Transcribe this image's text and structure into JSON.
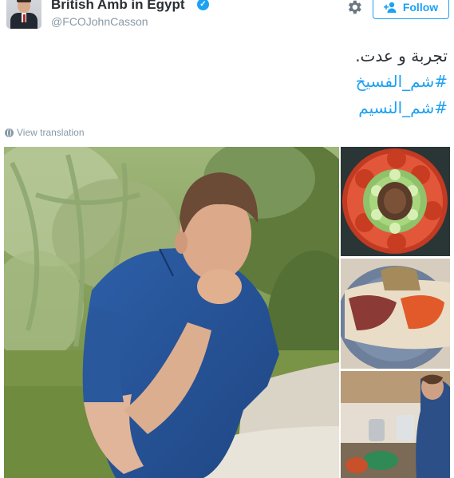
{
  "header": {
    "display_name": "British Amb in Egypt",
    "handle": "@FCOJohnCasson",
    "verified_icon": "verified-badge-icon",
    "follow_label": "Follow"
  },
  "tweet": {
    "lines": [
      "تجربة و عدت.",
      "#شم_الفسيخ",
      "#شم_النسيم"
    ],
    "view_translation": "View translation"
  },
  "media": {
    "photos": [
      "man-eating-photo",
      "fish-tomato-platter-photo",
      "plate-meal-photo",
      "kitchen-cooking-photo"
    ]
  },
  "colors": {
    "accent": "#1da1f2",
    "text": "#292f33",
    "muted": "#8899a6"
  }
}
